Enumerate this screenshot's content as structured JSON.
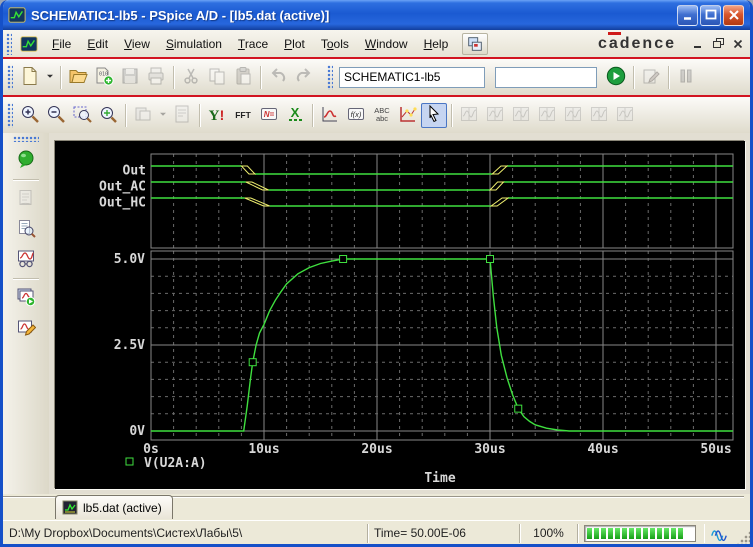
{
  "window": {
    "title": "SCHEMATIC1-lb5 - PSpice A/D - [lb5.dat (active)]"
  },
  "brand": {
    "logo_c": "c",
    "logo_a": "a",
    "logo_rest": "dence",
    "accent_color": "#cf1a1a"
  },
  "menubar": {
    "items": [
      {
        "label": "File",
        "accel": 0
      },
      {
        "label": "Edit",
        "accel": 0
      },
      {
        "label": "View",
        "accel": 0
      },
      {
        "label": "Simulation",
        "accel": 0
      },
      {
        "label": "Trace",
        "accel": 0
      },
      {
        "label": "Plot",
        "accel": 0
      },
      {
        "label": "Tools",
        "accel": 1
      },
      {
        "label": "Window",
        "accel": 0
      },
      {
        "label": "Help",
        "accel": 0
      }
    ]
  },
  "toolbar_main": {
    "groups": [
      [
        "new-file",
        "new-file-dropdown"
      ],
      [
        "open-file",
        "open-simulation-output",
        "save-file",
        "print"
      ],
      [
        "cut",
        "copy",
        "paste"
      ],
      [
        "undo",
        "redo"
      ]
    ],
    "right_groups": [
      [
        "run-simulation"
      ],
      [
        "edit-simulation-profile"
      ],
      [
        "pause-simulation"
      ]
    ],
    "disabled": [
      "save-file",
      "print",
      "cut",
      "copy",
      "paste",
      "undo",
      "redo",
      "edit-simulation-profile",
      "pause-simulation"
    ],
    "simulation_combo": "SCHEMATIC1-lb5",
    "status_value": ""
  },
  "toolbar_view": {
    "groups": [
      [
        "zoom-in",
        "zoom-out",
        "zoom-area",
        "zoom-fit"
      ],
      [
        "view-schematic-page",
        "page-dropdown",
        "view-output-log"
      ],
      [
        "view-simulation-messages",
        "fft",
        "evaluate-measurement",
        "performance-analysis"
      ],
      [
        "add-trace",
        "evaluate-function",
        "text-label",
        "mark-data-points",
        "select-arrow"
      ],
      [
        "cursor-toggle",
        "cursor-peak",
        "cursor-trough",
        "cursor-slope",
        "cursor-min",
        "cursor-max",
        "cursor-point"
      ]
    ],
    "disabled": [
      "view-schematic-page",
      "page-dropdown",
      "view-output-log",
      "cursor-toggle",
      "cursor-peak",
      "cursor-trough",
      "cursor-slope",
      "cursor-min",
      "cursor-max",
      "cursor-point"
    ],
    "pressed": [
      "select-arrow"
    ]
  },
  "sidebar": {
    "groups": [
      [
        "simulation-queue"
      ],
      [
        "view-output-file",
        "examine-output",
        "display-waveforms"
      ],
      [
        "run-profiles",
        "edit-profile"
      ]
    ],
    "disabled": [
      "view-output-file"
    ]
  },
  "chart_data": {
    "type": "line",
    "xlabel": "Time",
    "x_range_us": [
      0,
      51.5
    ],
    "x_major_step_us": 10,
    "x_minor_step_us": 2,
    "x_ticks": [
      {
        "t": 0,
        "label": "0s"
      },
      {
        "t": 10,
        "label": "10us"
      },
      {
        "t": 20,
        "label": "20us"
      },
      {
        "t": 30,
        "label": "30us"
      },
      {
        "t": 40,
        "label": "40us"
      },
      {
        "t": 50,
        "label": "50us"
      }
    ],
    "colors": {
      "background": "#000000",
      "trace": "#3fdf3f",
      "transition": "#efef6f",
      "grid_major": "#878787",
      "grid_minor": "#6c6c6c",
      "text": "#d8d8d8"
    },
    "digital": {
      "signals": [
        {
          "name": "Out",
          "initial": "high",
          "fall_us": 8.0,
          "fall_width_us": 1.2,
          "rise_us": 30.2,
          "rise_width_us": 1.3
        },
        {
          "name": "Out_AC",
          "initial": "high",
          "fall_us": 8.4,
          "fall_width_us": 2.0,
          "rise_us": 30.0,
          "rise_width_us": 1.2
        },
        {
          "name": "Out_HC",
          "initial": "high",
          "fall_us": 8.3,
          "fall_width_us": 2.2,
          "rise_us": 30.1,
          "rise_width_us": 1.5
        }
      ]
    },
    "analog": {
      "y_range": [
        0,
        5
      ],
      "y_minor_step": 0.5,
      "y_ticks": [
        {
          "v": 0,
          "label": "0V"
        },
        {
          "v": 2.5,
          "label": "2.5V"
        },
        {
          "v": 5,
          "label": "5.0V"
        }
      ],
      "series": [
        {
          "name": "V(U2A:A)",
          "points": [
            [
              0,
              0
            ],
            [
              8.2,
              0
            ],
            [
              8.5,
              0.7
            ],
            [
              8.8,
              1.5
            ],
            [
              9.0,
              2.0
            ],
            [
              9.3,
              2.5
            ],
            [
              9.6,
              2.85
            ],
            [
              10,
              3.1
            ],
            [
              10.5,
              3.5
            ],
            [
              11,
              3.8
            ],
            [
              11.5,
              4.05
            ],
            [
              12,
              4.28
            ],
            [
              13,
              4.57
            ],
            [
              14,
              4.75
            ],
            [
              15,
              4.87
            ],
            [
              16,
              4.94
            ],
            [
              17,
              5.0
            ],
            [
              30,
              5.0
            ],
            [
              30.3,
              3.9
            ],
            [
              30.6,
              3.0
            ],
            [
              31,
              2.2
            ],
            [
              31.5,
              1.55
            ],
            [
              32,
              1.05
            ],
            [
              32.5,
              0.65
            ],
            [
              33,
              0.42
            ],
            [
              33.5,
              0.28
            ],
            [
              34,
              0.18
            ],
            [
              35,
              0.08
            ],
            [
              36,
              0.03
            ],
            [
              37,
              0
            ],
            [
              51.5,
              0
            ]
          ],
          "markers": [
            [
              9.0,
              2.0
            ],
            [
              17.0,
              5.0
            ],
            [
              30.0,
              5.0
            ],
            [
              32.5,
              0.65
            ]
          ]
        }
      ],
      "legend": {
        "name": "V(U2A:A)"
      }
    }
  },
  "tabbar": {
    "tabs": [
      {
        "label": "lb5.dat (active)",
        "active": true
      }
    ]
  },
  "statusbar": {
    "path": "D:\\My Dropbox\\Documents\\Систех\\Лабы\\5\\",
    "time": "Time= 50.00E-06",
    "zoom": "100%",
    "progress_segments": 14
  }
}
